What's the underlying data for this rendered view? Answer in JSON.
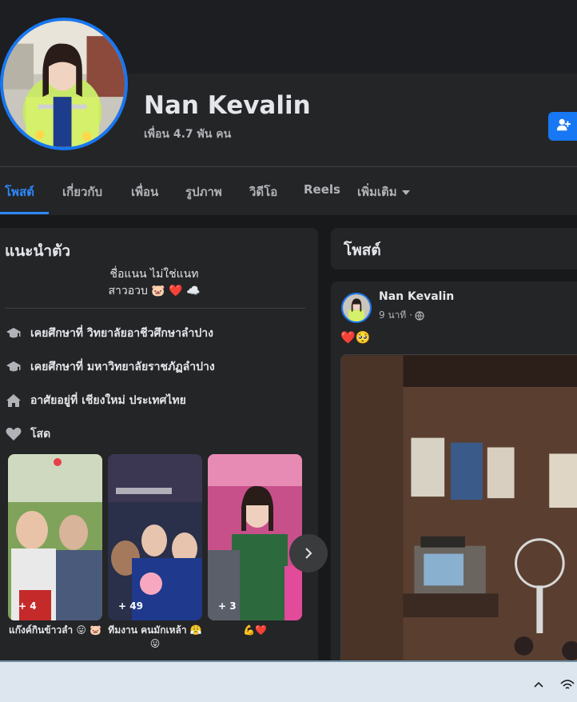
{
  "profile": {
    "name": "Nan Kevalin",
    "friends_count": "เพื่อน 4.7 พัน คน"
  },
  "tabs": [
    {
      "label": "โพสต์",
      "active": true
    },
    {
      "label": "เกี่ยวกับ",
      "active": false
    },
    {
      "label": "เพื่อน",
      "active": false
    },
    {
      "label": "รูปภาพ",
      "active": false
    },
    {
      "label": "วิดีโอ",
      "active": false
    },
    {
      "label": "Reels",
      "active": false
    },
    {
      "label": "เพิ่มเติม",
      "active": false
    }
  ],
  "intro": {
    "title": "แนะนำตัว",
    "bio_line1": "ชื่อแนน ไม่ใช่แนท",
    "bio_line2": "สาวอวบ 🐷 ❤️ ☁️",
    "items": [
      {
        "icon": "graduation-cap-icon",
        "text": "เคยศึกษาที่ วิทยาลัยอาชีวศึกษาลำปาง"
      },
      {
        "icon": "graduation-cap-icon",
        "text": "เคยศึกษาที่ มหาวิทยาลัยราชภัฏลำปาง"
      },
      {
        "icon": "home-icon",
        "text": "อาศัยอยู่ที่ เชียงใหม่ ประเทศไทย"
      },
      {
        "icon": "heart-icon",
        "text": "โสด"
      }
    ]
  },
  "featured": [
    {
      "count": "+ 4",
      "caption": "แก๊งค์กินข้าวลำ 😛 🐷"
    },
    {
      "count": "+ 49",
      "caption": "ทีมงาน คนมักเหล้า 😤😛"
    },
    {
      "count": "+ 3",
      "caption": "💪❤️"
    }
  ],
  "posts_section": {
    "title": "โพสต์"
  },
  "post": {
    "author": "Nan Kevalin",
    "time": "9 นาที ·",
    "text": "❤️🥺"
  },
  "colors": {
    "accent": "#2d88ff",
    "button_blue": "#1877f2",
    "card_bg": "#242526",
    "page_bg": "#18191a"
  }
}
